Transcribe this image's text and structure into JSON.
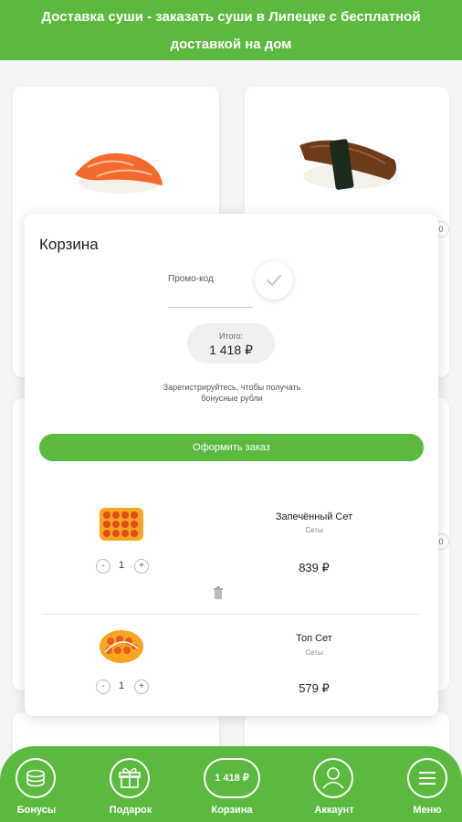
{
  "header": {
    "title": "Доставка суши - заказать суши в Липецке с бесплатной доставкой на дом"
  },
  "cart": {
    "title": "Корзина",
    "promo_label": "Промо-код",
    "promo_value": "",
    "total_label": "Итого:",
    "total_value": "1 418 ₽",
    "register_note": "Зарегистрируйтесь, чтобы получать бонусные рубли",
    "checkout_label": "Оформить заказ",
    "items": [
      {
        "name": "Запечённый Сет",
        "category": "Сеты",
        "quantity": "1",
        "price": "839 ₽"
      },
      {
        "name": "Топ Сет",
        "category": "Сеты",
        "quantity": "1",
        "price": "579 ₽"
      }
    ]
  },
  "nav": {
    "items": [
      {
        "label": "Бонусы",
        "icon": "coins-icon"
      },
      {
        "label": "Подарок",
        "icon": "gift-icon"
      },
      {
        "label": "Корзина",
        "icon": "cart-total",
        "value": "1 418 ₽"
      },
      {
        "label": "Аккаунт",
        "icon": "user-icon"
      },
      {
        "label": "Меню",
        "icon": "menu-icon"
      }
    ]
  },
  "colors": {
    "accent": "#5cb940",
    "background": "#f4f4f4",
    "card": "#ffffff"
  }
}
